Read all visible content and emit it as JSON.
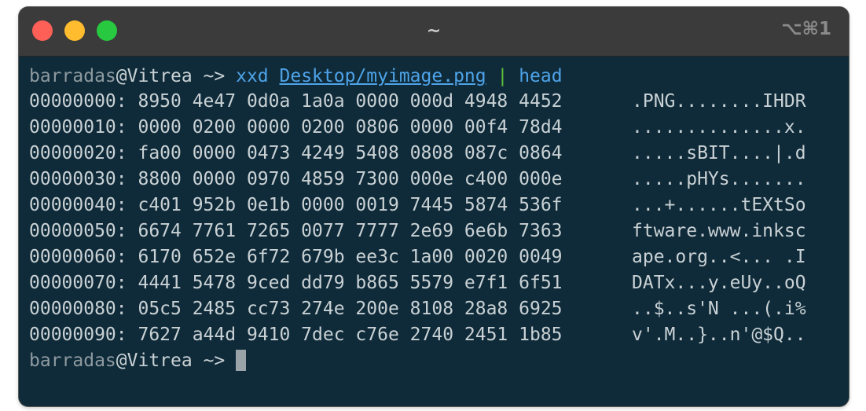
{
  "window": {
    "title": "~",
    "shortcut": "⌥⌘1"
  },
  "terminal": {
    "prompt1": {
      "user": "barradas",
      "host": "@Vitrea",
      "arrow": " ~> ",
      "cmd": "xxd",
      "arg": "Desktop/myimage.png",
      "pipe": "|",
      "cmd2": "head"
    },
    "rows": [
      {
        "hex": "00000000: 8950 4e47 0d0a 1a0a 0000 000d 4948 4452",
        "ascii": ".PNG........IHDR"
      },
      {
        "hex": "00000010: 0000 0200 0000 0200 0806 0000 00f4 78d4",
        "ascii": "..............x."
      },
      {
        "hex": "00000020: fa00 0000 0473 4249 5408 0808 087c 0864",
        "ascii": ".....sBIT....|.d"
      },
      {
        "hex": "00000030: 8800 0000 0970 4859 7300 000e c400 000e",
        "ascii": ".....pHYs......."
      },
      {
        "hex": "00000040: c401 952b 0e1b 0000 0019 7445 5874 536f",
        "ascii": "...+......tEXtSo"
      },
      {
        "hex": "00000050: 6674 7761 7265 0077 7777 2e69 6e6b 7363",
        "ascii": "ftware.www.inksc"
      },
      {
        "hex": "00000060: 6170 652e 6f72 679b ee3c 1a00 0020 0049",
        "ascii": "ape.org..<... .I"
      },
      {
        "hex": "00000070: 4441 5478 9ced dd79 b865 5579 e7f1 6f51",
        "ascii": "DATx...y.eUy..oQ"
      },
      {
        "hex": "00000080: 05c5 2485 cc73 274e 200e 8108 28a8 6925",
        "ascii": "..$..s'N ...(.i%"
      },
      {
        "hex": "00000090: 7627 a44d 9410 7dec c76e 2740 2451 1b85",
        "ascii": "v'.M..}..n'@$Q.."
      }
    ],
    "prompt2": {
      "user": "barradas",
      "host": "@Vitrea",
      "arrow": " ~> "
    }
  }
}
